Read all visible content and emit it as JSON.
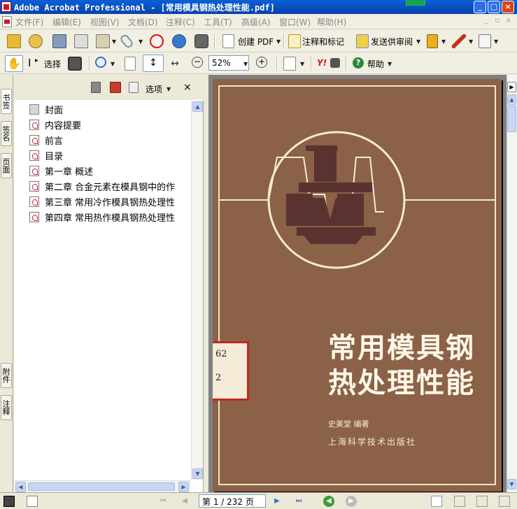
{
  "window": {
    "title": "Adobe Acrobat Professional - [常用模具钢热处理性能.pdf]",
    "buttons": [
      "_",
      "□",
      "×"
    ]
  },
  "menu": [
    "文件(F)",
    "编辑(E)",
    "视图(V)",
    "文档(D)",
    "注释(C)",
    "工具(T)",
    "高级(A)",
    "窗口(W)",
    "帮助(H)"
  ],
  "toolbar1": {
    "create_pdf": "创建 PDF",
    "comment_markup": "注释和标记",
    "send_review": "发送供审阅"
  },
  "toolbar2": {
    "select": "选择",
    "zoom": "52%",
    "help": "帮助",
    "yahoo": "Y!"
  },
  "left_tabs": [
    "书签",
    "签名",
    "页面",
    "附件",
    "注释"
  ],
  "bookmarks_panel": {
    "options": "选项",
    "close": "×",
    "items": [
      {
        "label": "封面",
        "icon": "page-icon"
      },
      {
        "label": "内容提要",
        "icon": "pdf-page-icon"
      },
      {
        "label": "前言",
        "icon": "pdf-page-icon"
      },
      {
        "label": "目录",
        "icon": "pdf-page-icon"
      },
      {
        "label": "第一章 概述",
        "icon": "pdf-page-icon"
      },
      {
        "label": "第二章 合金元素在模具钢中的作",
        "icon": "pdf-page-icon"
      },
      {
        "label": "第三章 常用冷作模具钢热处理性",
        "icon": "pdf-page-icon"
      },
      {
        "label": "第四章 常用热作模具钢热处理性",
        "icon": "pdf-page-icon"
      }
    ]
  },
  "cover": {
    "title_line1": "常用模具钢",
    "title_line2": "热处理性能",
    "author": "史美堂  编著",
    "publisher": "上海科学技术出版社",
    "sticker_line1": "62",
    "sticker_line2": "2"
  },
  "status": {
    "page_indicator": "第 1 / 232 页"
  },
  "colors": {
    "titlebar": "#0842a8",
    "cover_brown": "#8b6247",
    "cover_line": "#f2e6cf",
    "sticker_red": "#c4261e"
  }
}
